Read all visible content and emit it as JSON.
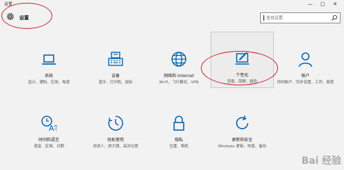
{
  "window": {
    "title": "设置",
    "controls": [
      "—",
      "□",
      "✕"
    ]
  },
  "header": {
    "title": "设置",
    "search_placeholder": "查找设置"
  },
  "tiles": [
    {
      "title": "系统",
      "desc": "显示、通知、应用、电源",
      "icon": "laptop-icon"
    },
    {
      "title": "设备",
      "desc": "蓝牙、打印机、鼠标",
      "icon": "keyboard-icon"
    },
    {
      "title": "网络和 Internet",
      "desc": "Wi-Fi、飞行模式、VPN",
      "icon": "globe-icon"
    },
    {
      "title": "个性化",
      "desc": "背景、锁屏、颜色",
      "icon": "paint-icon"
    },
    {
      "title": "帐户",
      "desc": "你的帐户、同步设置、工作、家庭",
      "icon": "person-icon"
    },
    {
      "title": "时间和语言",
      "desc": "语音、区域、日期",
      "icon": "time-language-icon"
    },
    {
      "title": "轻松使用",
      "desc": "讲述人、放大镜、高对比度",
      "icon": "ease-of-access-icon"
    },
    {
      "title": "隐私",
      "desc": "位置、相机",
      "icon": "lock-icon"
    },
    {
      "title": "更新和安全",
      "desc": "Windows 更新、恢复、备份",
      "icon": "update-icon"
    }
  ],
  "watermark": "Bai 经验",
  "colors": {
    "accent": "#0063b1",
    "highlight": "#c0202a"
  }
}
